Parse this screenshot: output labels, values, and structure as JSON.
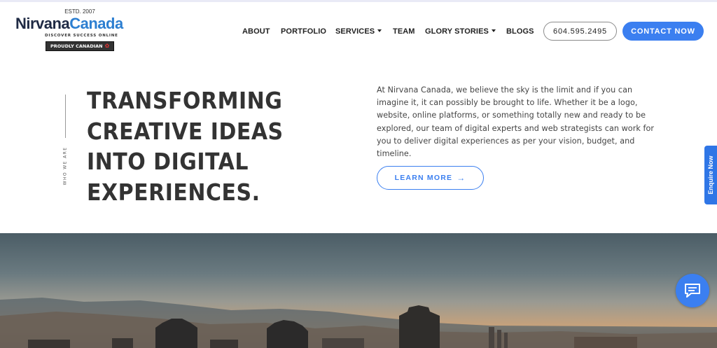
{
  "logo": {
    "estd": "ESTD. 2007",
    "name_part1": "Nirvana",
    "name_part2": "Canada",
    "tagline": "DISCOVER SUCCESS ONLINE",
    "badge": "PROUDLY CANADIAN"
  },
  "nav": {
    "items": [
      {
        "label": "ABOUT",
        "dropdown": false
      },
      {
        "label": "PORTFOLIO",
        "dropdown": false
      },
      {
        "label": "SERVICES",
        "dropdown": true
      },
      {
        "label": "TEAM",
        "dropdown": false
      },
      {
        "label": "GLORY STORIES",
        "dropdown": true
      },
      {
        "label": "BLOGS",
        "dropdown": false
      }
    ],
    "phone": "604.595.2495",
    "contact_label": "CONTACT NOW"
  },
  "hero": {
    "side_label": "WHO WE ARE",
    "headline_lines": [
      "TRANSFORMING",
      "CREATIVE IDEAS",
      "INTO DIGITAL",
      "EXPERIENCES."
    ],
    "intro": "At Nirvana Canada, we believe the sky is the limit and if you can imagine it, it can possibly be brought to life. Whether it be a logo, website, online platforms, or something totally new and ready to be explored, our team of digital experts and web strategists can work for you to deliver digital experiences as per your vision, budget, and timeline.",
    "learn_more_label": "LEARN MORE",
    "learn_more_arrow": "→"
  },
  "enquire_label": "Enquire Now",
  "icons": {
    "badge_flag": "maple-leaf-icon",
    "chat": "chat-bubble-icon",
    "dropdown": "chevron-down-icon"
  },
  "colors": {
    "brand_dark": "#1f2a44",
    "brand_blue": "#2d7fd1",
    "accent": "#3b7ff0",
    "text": "#333333"
  }
}
